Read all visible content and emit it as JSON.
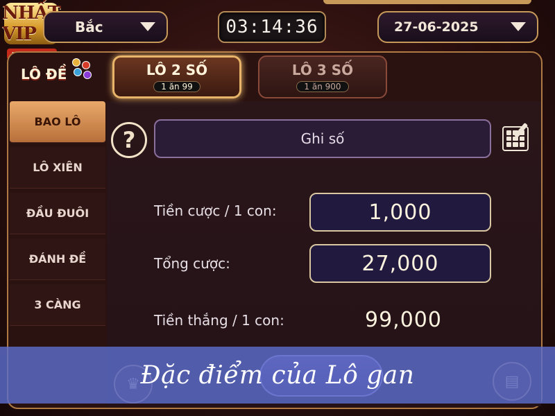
{
  "header": {
    "logo_text": "NHẤT VIP",
    "logo_url": "NHATVIP.VET",
    "region": "Bắc",
    "clock": "03:14:36",
    "date": "27-06-2025"
  },
  "sidebar": {
    "logo_text": "LÔ ĐỀ",
    "items": [
      {
        "label": "BAO LÔ"
      },
      {
        "label": "LÔ XIÊN"
      },
      {
        "label": "ĐẦU ĐUÔI"
      },
      {
        "label": "ĐÁNH ĐỀ"
      },
      {
        "label": "3 CÀNG"
      }
    ],
    "active_index": 0
  },
  "tabs": [
    {
      "title": "LÔ 2 SỐ",
      "odds": "1 ăn 99"
    },
    {
      "title": "LÔ 3 SỐ",
      "odds": "1 ăn 900"
    }
  ],
  "form": {
    "help_symbol": "?",
    "number_placeholder": "Ghi số",
    "stake_label": "Tiền cược / 1 con:",
    "stake_value": "1,000",
    "total_label": "Tổng cược:",
    "total_value": "27,000",
    "win_label": "Tiền thắng / 1 con:",
    "win_value": "99,000"
  },
  "caption": "Đặc điểm của Lô gan",
  "icons": [
    "trophy-icon",
    "history-icon",
    "keypad-icon",
    "help-icon",
    "chevron-down-icon"
  ],
  "colors": {
    "gold_accent": "#e7b46a",
    "caption_bg": "#5c6ccc",
    "active_sidebar": "#e9a96a"
  }
}
